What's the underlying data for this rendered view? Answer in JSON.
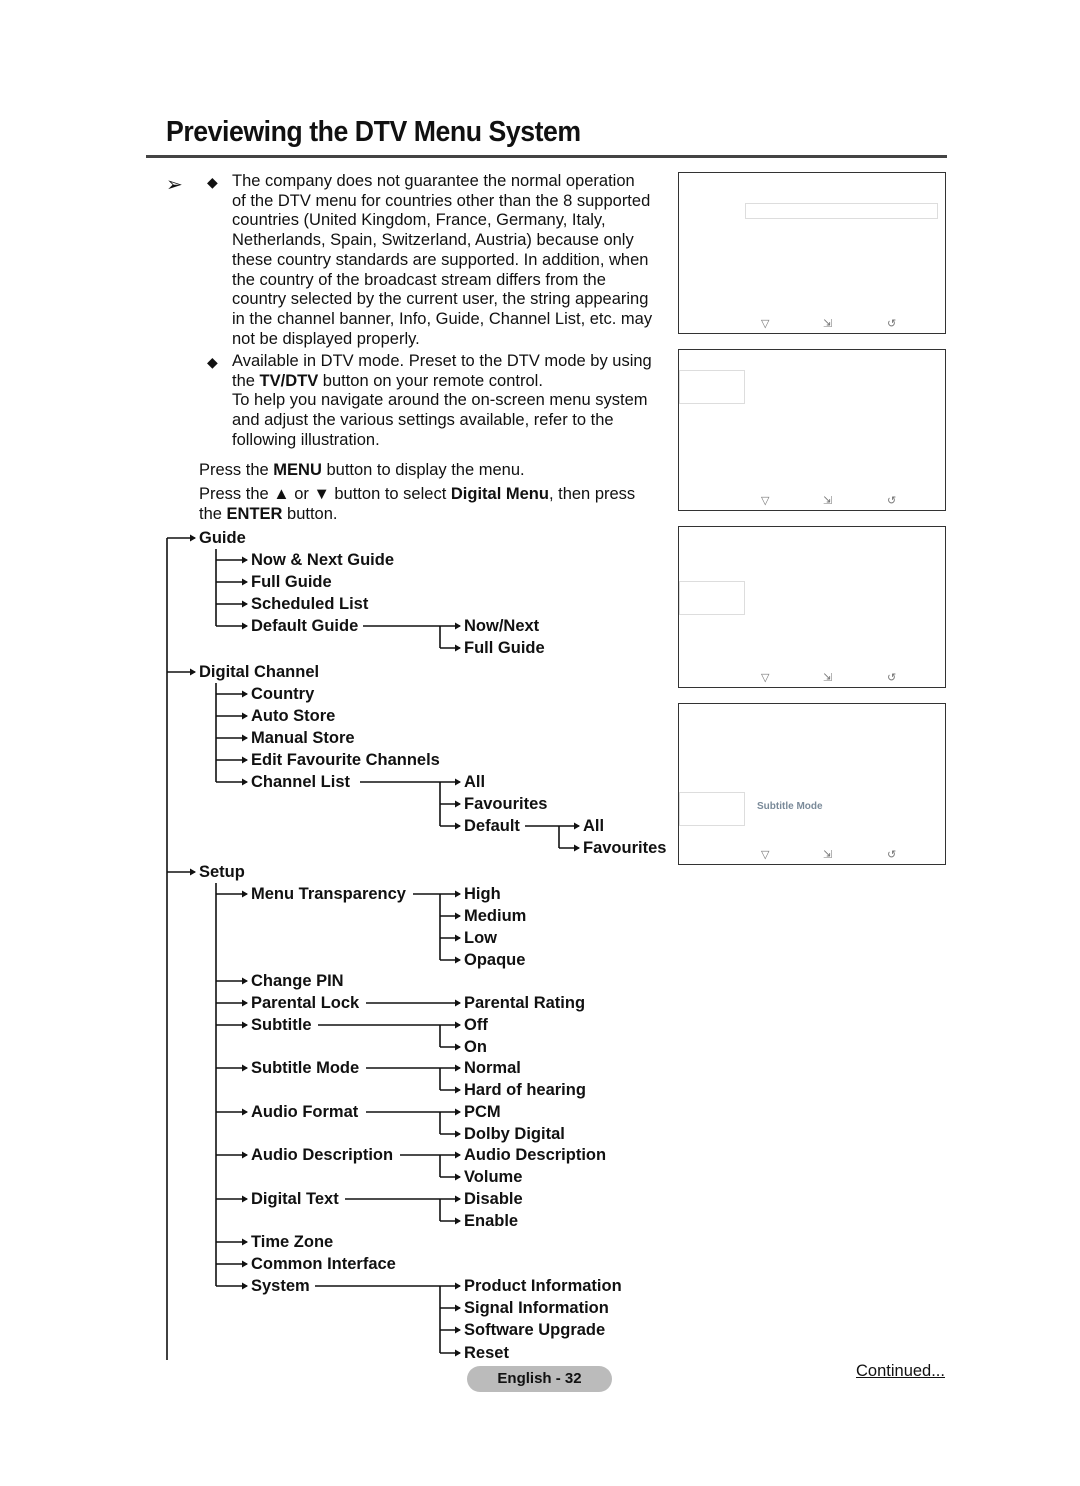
{
  "page": {
    "title": "Previewing the DTV Menu System",
    "note_arrow": "➢",
    "bullet_glyph": "◆",
    "notes": [
      [
        "The company does not guarantee the normal operation",
        "of the DTV menu for countries other than the 8 supported",
        "countries (United Kingdom, France, Germany, Italy,",
        "Netherlands, Spain, Switzerland, Austria) because only",
        "these country standards are supported. In addition, when",
        "the country of the broadcast stream differs from the",
        "country selected by the current user, the string appearing",
        "in the channel banner, Info, Guide, Channel List, etc. may",
        "not be displayed properly."
      ],
      [
        "Available in DTV mode. Preset to the DTV mode by using"
      ]
    ],
    "note2_line2": {
      "pre": "the ",
      "bold": "TV/DTV",
      "post": " button on your remote control."
    },
    "note2_rest": [
      "To help you navigate around the on-screen menu system",
      "and adjust the various settings available, refer to the",
      "following illustration."
    ],
    "step1": {
      "pre": "Press the ",
      "bold": "MENU",
      "post": " button to display the menu."
    },
    "step2": {
      "pre": "Press the ▲ or ▼ button to select ",
      "bold": "Digital Menu",
      "post": ", then press"
    },
    "step2b": {
      "pre": "the ",
      "bold": "ENTER",
      "post": " button."
    },
    "footer": "English - 32",
    "continued": "Continued..."
  },
  "panels": [
    {
      "label": ""
    },
    {
      "label": ""
    },
    {
      "label": ""
    },
    {
      "label": "Subtitle Mode"
    }
  ],
  "panel_icons": {
    "move": "▽",
    "enter": "⇲",
    "return": "↺"
  },
  "tree": {
    "guide": {
      "label": "Guide",
      "children": [
        "Now & Next Guide",
        "Full Guide",
        "Scheduled List",
        "Default Guide"
      ],
      "default_guide_options": [
        "Now/Next",
        "Full Guide"
      ]
    },
    "digital_channel": {
      "label": "Digital Channel",
      "children": [
        "Country",
        "Auto Store",
        "Manual Store",
        "Edit Favourite Channels",
        "Channel List"
      ],
      "channel_list_options": [
        "All",
        "Favourites",
        "Default"
      ],
      "default_options": [
        "All",
        "Favourites"
      ]
    },
    "setup": {
      "label": "Setup",
      "children": [
        "Menu Transparency",
        "Change PIN",
        "Parental Lock",
        "Subtitle",
        "Subtitle Mode",
        "Audio Format",
        "Audio Description",
        "Digital Text",
        "Time Zone",
        "Common Interface",
        "System"
      ],
      "menu_transparency_options": [
        "High",
        "Medium",
        "Low",
        "Opaque"
      ],
      "parental_lock_options": [
        "Parental Rating"
      ],
      "subtitle_options": [
        "Off",
        "On"
      ],
      "subtitle_mode_options": [
        "Normal",
        "Hard of hearing"
      ],
      "audio_format_options": [
        "PCM",
        "Dolby Digital"
      ],
      "audio_description_options": [
        "Audio Description",
        "Volume"
      ],
      "digital_text_options": [
        "Disable",
        "Enable"
      ],
      "system_options": [
        "Product Information",
        "Signal Information",
        "Software Upgrade",
        "Reset"
      ]
    }
  }
}
